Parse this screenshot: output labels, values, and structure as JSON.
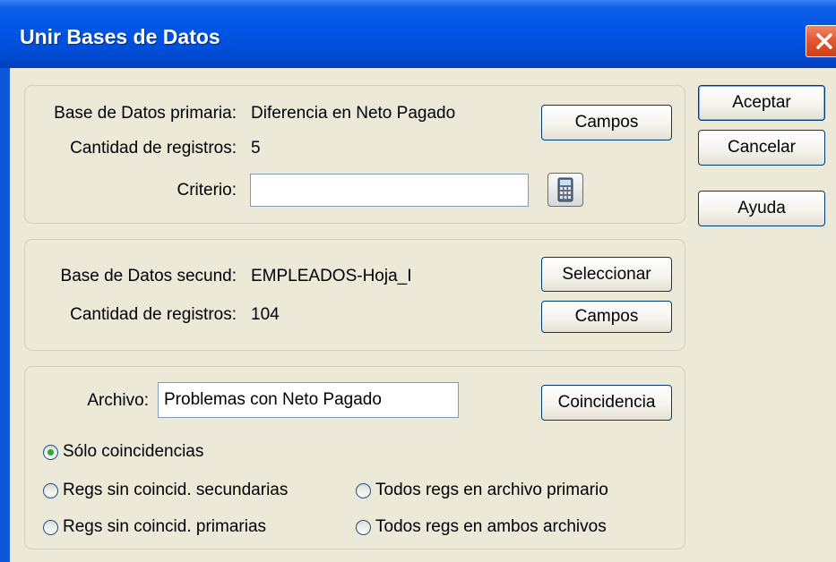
{
  "window": {
    "title": "Unir Bases de Datos"
  },
  "primary": {
    "db_label": "Base de Datos primaria:",
    "db_value": "Diferencia en Neto Pagado",
    "count_label": "Cantidad de registros:",
    "count_value": "5",
    "criteria_label": "Criterio:",
    "criteria_value": "",
    "fields_button": "Campos"
  },
  "secondary": {
    "db_label": "Base de Datos secund:",
    "db_value": "EMPLEADOS-Hoja_I",
    "count_label": "Cantidad de registros:",
    "count_value": "104",
    "select_button": "Seleccionar",
    "fields_button": "Campos"
  },
  "output": {
    "file_label": "Archivo:",
    "file_value": "Problemas con Neto Pagado",
    "match_button": "Coincidencia",
    "options": [
      {
        "label": "Sólo coincidencias",
        "selected": true
      },
      {
        "label": "Regs sin coincid. secundarias",
        "selected": false
      },
      {
        "label": "Todos regs en archivo primario",
        "selected": false
      },
      {
        "label": "Regs sin coincid. primarias",
        "selected": false
      },
      {
        "label": "Todos regs en ambos archivos",
        "selected": false
      }
    ]
  },
  "actions": {
    "accept": "Aceptar",
    "cancel": "Cancelar",
    "help": "Ayuda"
  },
  "icons": {
    "close": "close-icon",
    "calculator": "calculator-icon"
  }
}
